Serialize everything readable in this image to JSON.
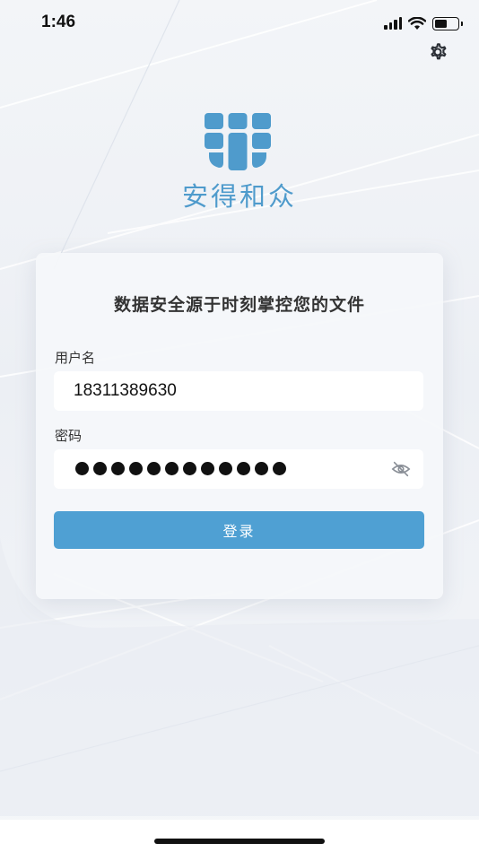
{
  "status_bar": {
    "time": "1:46",
    "signal_icon": "cellular-signal-icon",
    "wifi_icon": "wifi-icon",
    "battery_icon": "battery-icon",
    "battery_level": 0.55
  },
  "header": {
    "settings_icon": "gear-icon"
  },
  "brand": {
    "logo_icon": "brand-logo-icon",
    "name": "安得和众",
    "color": "#4f9bcc"
  },
  "login_card": {
    "headline": "数据安全源于时刻掌控您的文件",
    "username": {
      "label": "用户名",
      "value": "18311389630"
    },
    "password": {
      "label": "密码",
      "masked_length": 12,
      "toggle_icon": "eye-off-icon"
    },
    "submit_label": "登录",
    "accent_color": "#4fa0d3"
  }
}
